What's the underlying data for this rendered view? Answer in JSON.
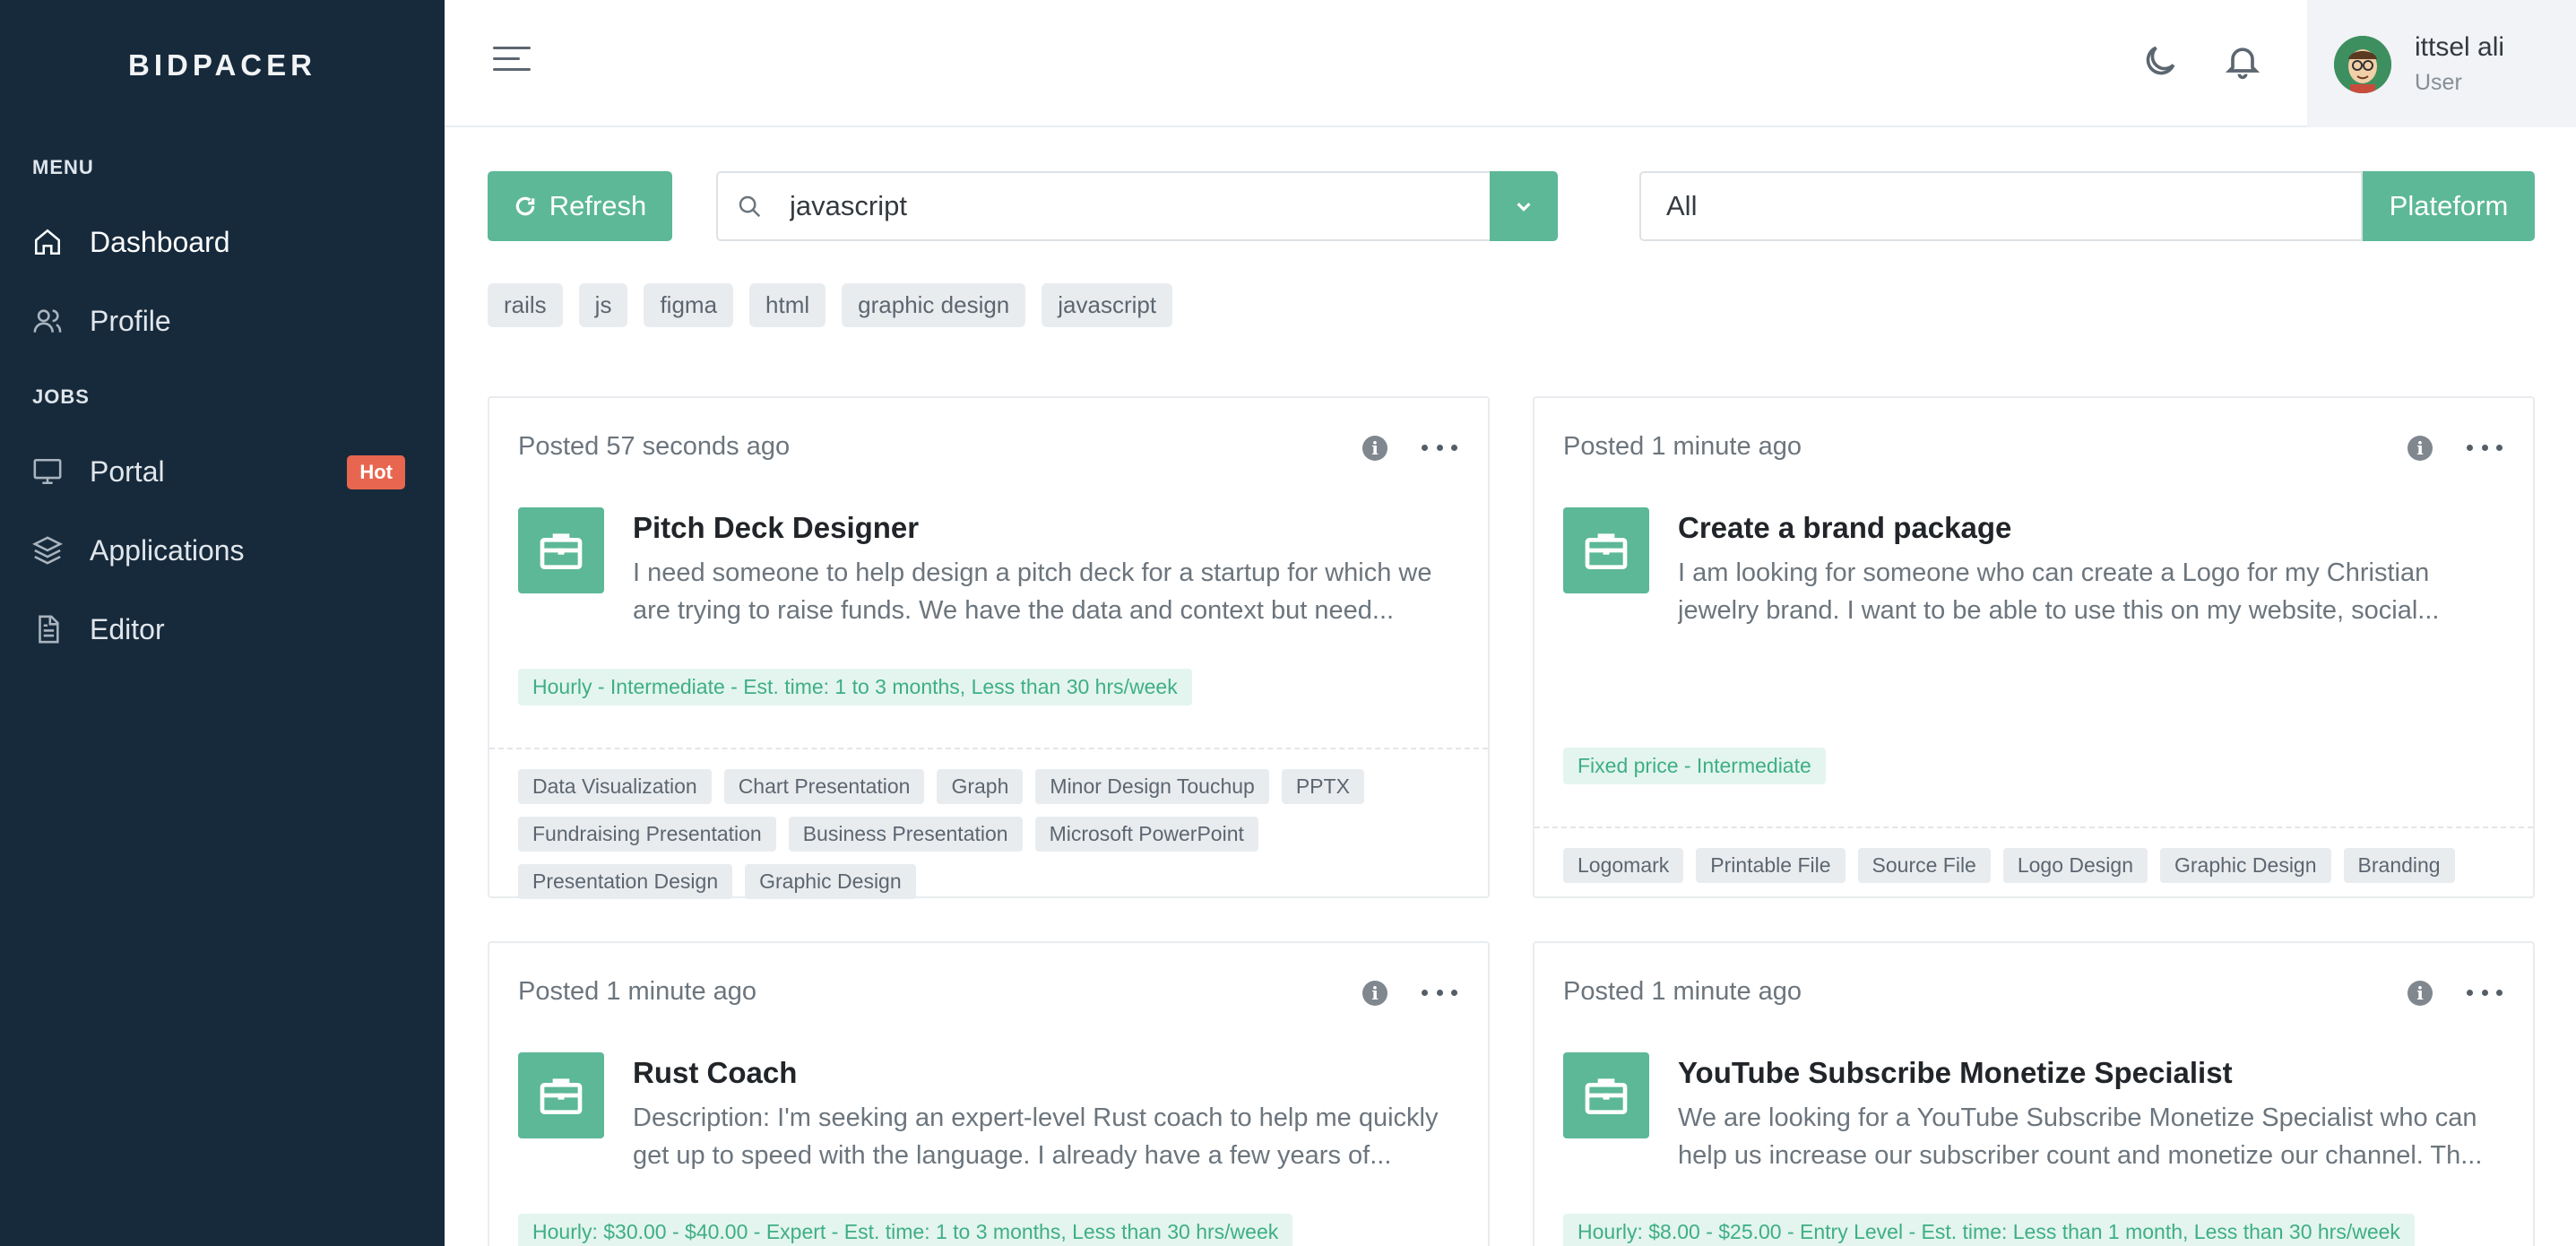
{
  "logo": "BIDPACER",
  "sidebar": {
    "menu_title": "MENU",
    "jobs_title": "JOBS",
    "items": [
      {
        "label": "Dashboard"
      },
      {
        "label": "Profile"
      },
      {
        "label": "Portal",
        "badge": "Hot"
      },
      {
        "label": "Applications"
      },
      {
        "label": "Editor"
      }
    ]
  },
  "header": {
    "user_name": "ittsel ali",
    "user_role": "User"
  },
  "toolbar": {
    "refresh_label": "Refresh",
    "search_value": "javascript",
    "select_value": "All",
    "platform_label": "Plateform"
  },
  "tags": [
    "rails",
    "js",
    "figma",
    "html",
    "graphic design",
    "javascript"
  ],
  "cards": [
    {
      "posted": "Posted 57 seconds ago",
      "title": "Pitch Deck Designer",
      "description": "I need someone to help design a pitch deck for a startup for which we are trying to raise funds. We have the data and context but need...",
      "meta": "Hourly - Intermediate - Est. time: 1 to 3 months, Less than 30 hrs/week",
      "skills": [
        "Data Visualization",
        "Chart Presentation",
        "Graph",
        "Minor Design Touchup",
        "PPTX",
        "Fundraising Presentation",
        "Business Presentation",
        "Microsoft PowerPoint",
        "Presentation Design",
        "Graphic Design"
      ]
    },
    {
      "posted": "Posted 1 minute ago",
      "title": "Create a brand package",
      "description": "I am looking for someone who can create a Logo for my Christian jewelry brand. I want to be able to use this on my website, social...",
      "meta": "Fixed price - Intermediate",
      "skills": [
        "Logomark",
        "Printable File",
        "Source File",
        "Logo Design",
        "Graphic Design",
        "Branding"
      ]
    },
    {
      "posted": "Posted 1 minute ago",
      "title": "Rust Coach",
      "description": "Description: I'm seeking an expert-level Rust coach to help me quickly get up to speed with the language. I already have a few years of...",
      "meta": "Hourly: $30.00 - $40.00 - Expert - Est. time: 1 to 3 months, Less than 30 hrs/week",
      "skills": []
    },
    {
      "posted": "Posted 1 minute ago",
      "title": "YouTube Subscribe Monetize Specialist",
      "description": "We are looking for a YouTube Subscribe Monetize Specialist who can help us increase our subscriber count and monetize our channel. Th...",
      "meta": "Hourly: $8.00 - $25.00 - Entry Level - Est. time: Less than 1 month, Less than 30 hrs/week",
      "skills": []
    }
  ],
  "colors": {
    "sidebar_bg": "#162a3c",
    "accent": "#5cb897",
    "hot_badge": "#e8664f"
  }
}
